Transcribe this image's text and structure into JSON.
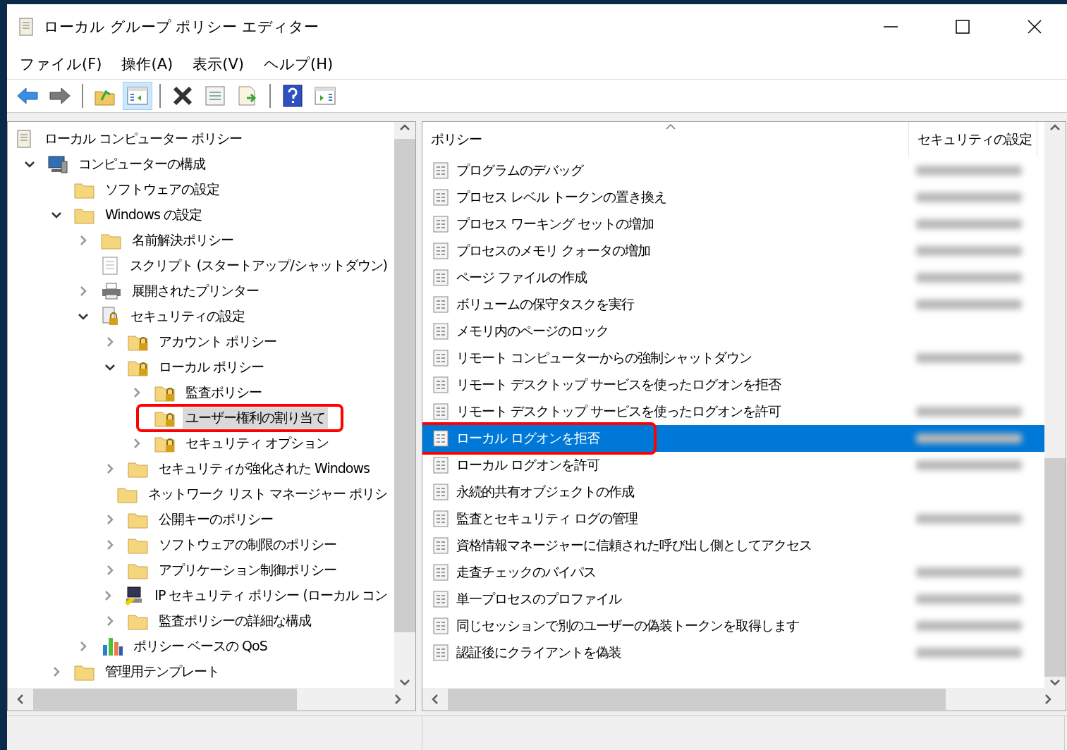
{
  "window": {
    "title": "ローカル グループ ポリシー エディター"
  },
  "menu": [
    "ファイル(F)",
    "操作(A)",
    "表示(V)",
    "ヘルプ(H)"
  ],
  "toolbar": [
    {
      "kind": "back",
      "pressed": false
    },
    {
      "kind": "forward",
      "pressed": false
    },
    {
      "kind": "separator"
    },
    {
      "kind": "up",
      "pressed": false
    },
    {
      "kind": "tree",
      "pressed": true
    },
    {
      "kind": "separator"
    },
    {
      "kind": "delete",
      "pressed": false
    },
    {
      "kind": "properties",
      "pressed": false
    },
    {
      "kind": "export",
      "pressed": false
    },
    {
      "kind": "separator"
    },
    {
      "kind": "help",
      "pressed": false
    },
    {
      "kind": "actions",
      "pressed": false
    }
  ],
  "tree": [
    {
      "label": "ローカル コンピューター ポリシー",
      "kind": "policy",
      "selected": false,
      "children": [
        {
          "label": "コンピューターの構成",
          "kind": "computer",
          "expanded": true,
          "selected": false,
          "children": [
            {
              "label": "ソフトウェアの設定",
              "kind": "folder",
              "selected": false
            },
            {
              "label": "Windows の設定",
              "kind": "folder",
              "expanded": true,
              "selected": false,
              "children": [
                {
                  "label": "名前解決ポリシー",
                  "kind": "folder",
                  "expanded": false,
                  "selected": false
                },
                {
                  "label": "スクリプト (スタートアップ/シャットダウン)",
                  "kind": "script",
                  "selected": false
                },
                {
                  "label": "展開されたプリンター",
                  "kind": "printer",
                  "expanded": false,
                  "selected": false
                },
                {
                  "label": "セキュリティの設定",
                  "kind": "secure",
                  "expanded": true,
                  "selected": false,
                  "children": [
                    {
                      "label": "アカウント ポリシー",
                      "kind": "lockfolder",
                      "expanded": false,
                      "selected": false
                    },
                    {
                      "label": "ローカル ポリシー",
                      "kind": "lockfolder",
                      "expanded": true,
                      "selected": false,
                      "children": [
                        {
                          "label": "監査ポリシー",
                          "kind": "lockfolder",
                          "expanded": false,
                          "selected": false
                        },
                        {
                          "label": "ユーザー権利の割り当て",
                          "kind": "lockfolder",
                          "selected": true,
                          "callout": true
                        },
                        {
                          "label": "セキュリティ オプション",
                          "kind": "lockfolder",
                          "expanded": false,
                          "selected": false
                        }
                      ]
                    },
                    {
                      "label": "セキュリティが強化された Windows",
                      "kind": "folder",
                      "expanded": false,
                      "selected": false
                    },
                    {
                      "label": "ネットワーク リスト マネージャー ポリシ",
                      "kind": "folder",
                      "selected": false
                    },
                    {
                      "label": "公開キーのポリシー",
                      "kind": "folder",
                      "expanded": false,
                      "selected": false
                    },
                    {
                      "label": "ソフトウェアの制限のポリシー",
                      "kind": "folder",
                      "expanded": false,
                      "selected": false
                    },
                    {
                      "label": "アプリケーション制御ポリシー",
                      "kind": "folder",
                      "expanded": false,
                      "selected": false
                    },
                    {
                      "label": "IP セキュリティ ポリシー (ローカル コン",
                      "kind": "ip",
                      "expanded": false,
                      "selected": false
                    },
                    {
                      "label": "監査ポリシーの詳細な構成",
                      "kind": "folder",
                      "expanded": false,
                      "selected": false
                    }
                  ]
                },
                {
                  "label": "ポリシー ベースの QoS",
                  "kind": "chart",
                  "expanded": false,
                  "selected": false
                }
              ]
            },
            {
              "label": "管理用テンプレート",
              "kind": "folder",
              "expanded": false,
              "selected": false
            }
          ]
        }
      ]
    }
  ],
  "list": {
    "columns": [
      "ポリシー",
      "セキュリティの設定"
    ],
    "rows": [
      {
        "name": "プログラムのデバッグ",
        "value_blurred": true,
        "selected": false
      },
      {
        "name": "プロセス レベル トークンの置き換え",
        "value_blurred": true,
        "selected": false
      },
      {
        "name": "プロセス ワーキング セットの増加",
        "value_blurred": true,
        "selected": false
      },
      {
        "name": "プロセスのメモリ クォータの増加",
        "value_blurred": true,
        "selected": false
      },
      {
        "name": "ページ ファイルの作成",
        "value_blurred": true,
        "selected": false
      },
      {
        "name": "ボリュームの保守タスクを実行",
        "value_blurred": true,
        "selected": false
      },
      {
        "name": "メモリ内のページのロック",
        "value_blurred": false,
        "selected": false
      },
      {
        "name": "リモート コンピューターからの強制シャットダウン",
        "value_blurred": true,
        "selected": false
      },
      {
        "name": "リモート デスクトップ サービスを使ったログオンを拒否",
        "value_blurred": false,
        "selected": false
      },
      {
        "name": "リモート デスクトップ サービスを使ったログオンを許可",
        "value_blurred": true,
        "selected": false
      },
      {
        "name": "ローカル ログオンを拒否",
        "value_blurred": true,
        "selected": true,
        "callout": true
      },
      {
        "name": "ローカル ログオンを許可",
        "value_blurred": true,
        "selected": false
      },
      {
        "name": "永続的共有オブジェクトの作成",
        "value_blurred": false,
        "selected": false
      },
      {
        "name": "監査とセキュリティ ログの管理",
        "value_blurred": true,
        "selected": false
      },
      {
        "name": "資格情報マネージャーに信頼された呼び出し側としてアクセス",
        "value_blurred": false,
        "selected": false
      },
      {
        "name": "走査チェックのバイパス",
        "value_blurred": true,
        "selected": false
      },
      {
        "name": "単一プロセスのプロファイル",
        "value_blurred": true,
        "selected": false
      },
      {
        "name": "同じセッションで別のユーザーの偽装トークンを取得します",
        "value_blurred": true,
        "selected": false
      },
      {
        "name": "認証後にクライアントを偽装",
        "value_blurred": true,
        "selected": false
      }
    ]
  }
}
